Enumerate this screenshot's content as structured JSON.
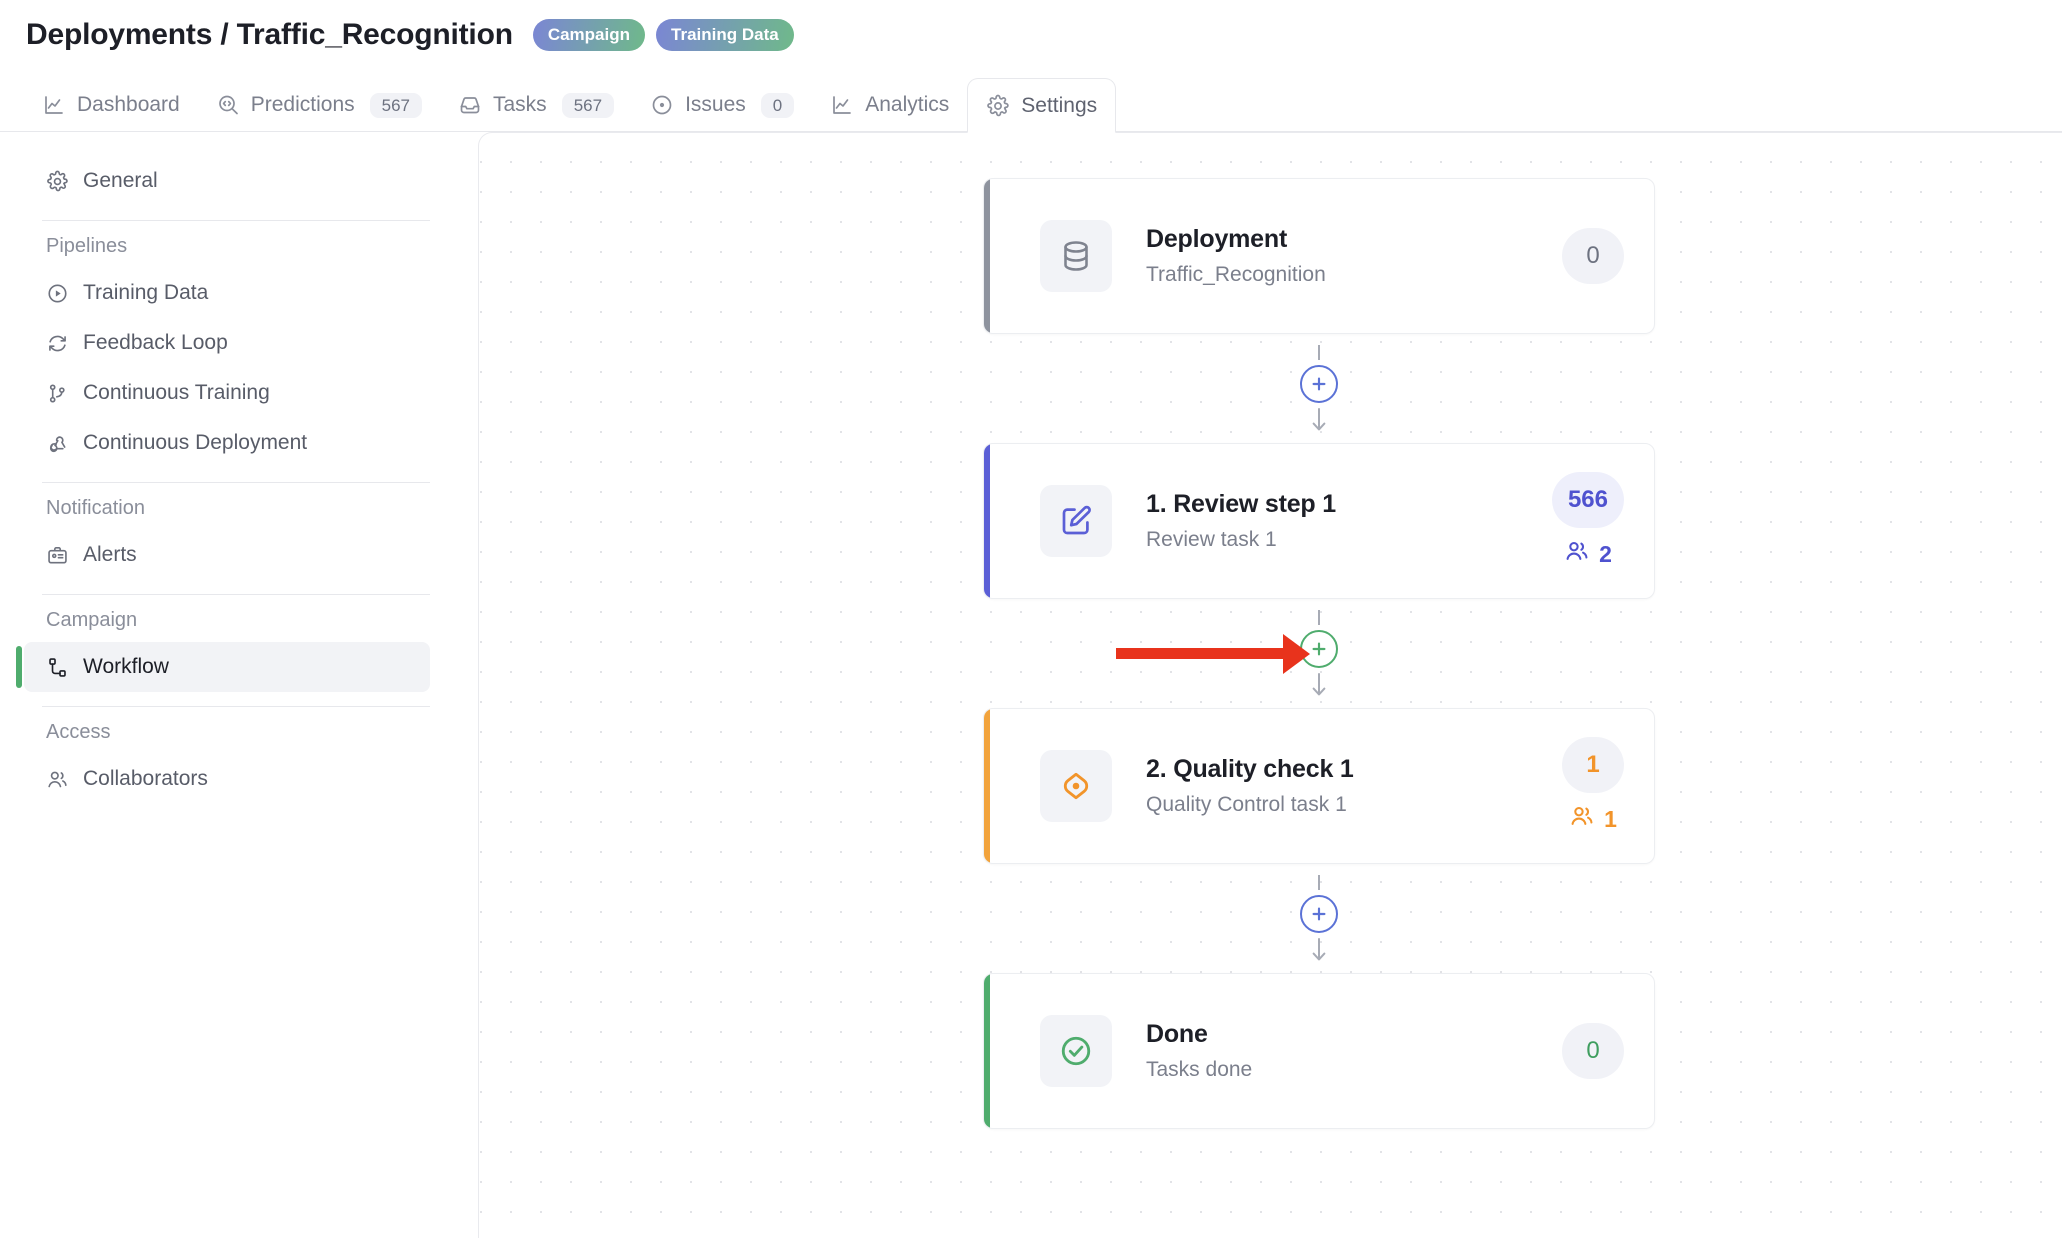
{
  "header": {
    "breadcrumb": "Deployments / Traffic_Recognition",
    "tags": [
      {
        "label": "Campaign",
        "color": "#7b86d4"
      },
      {
        "label": "Training Data",
        "color": "#7b86d4"
      }
    ]
  },
  "tabs": [
    {
      "label": "Dashboard",
      "icon": "chart-line-icon",
      "badge": null,
      "active": false
    },
    {
      "label": "Predictions",
      "icon": "code-search-icon",
      "badge": "567",
      "active": false
    },
    {
      "label": "Tasks",
      "icon": "inbox-icon",
      "badge": "567",
      "active": false
    },
    {
      "label": "Issues",
      "icon": "target-dot-icon",
      "badge": "0",
      "active": false
    },
    {
      "label": "Analytics",
      "icon": "chart-line-icon",
      "badge": null,
      "active": false
    },
    {
      "label": "Settings",
      "icon": "gear-icon",
      "badge": null,
      "active": true
    }
  ],
  "sidebar": {
    "top_item": {
      "label": "General",
      "icon": "gear-icon"
    },
    "groups": [
      {
        "title": "Pipelines",
        "items": [
          {
            "label": "Training Data",
            "icon": "play-circle-icon",
            "active": false
          },
          {
            "label": "Feedback Loop",
            "icon": "refresh-icon",
            "active": false
          },
          {
            "label": "Continuous Training",
            "icon": "git-branch-icon",
            "active": false
          },
          {
            "label": "Continuous Deployment",
            "icon": "webhook-icon",
            "active": false
          }
        ]
      },
      {
        "title": "Notification",
        "items": [
          {
            "label": "Alerts",
            "icon": "id-card-icon",
            "active": false
          }
        ]
      },
      {
        "title": "Campaign",
        "items": [
          {
            "label": "Workflow",
            "icon": "workflow-icon",
            "active": true
          }
        ]
      },
      {
        "title": "Access",
        "items": [
          {
            "label": "Collaborators",
            "icon": "users-icon",
            "active": false
          }
        ]
      }
    ],
    "active_accent": "#4fac6d"
  },
  "workflow": {
    "nodes": [
      {
        "title": "Deployment",
        "subtitle": "Traffic_Recognition",
        "count": "0",
        "assignees": null,
        "icon": "database-icon",
        "accent": "gray",
        "accent_color": "#8e939e"
      },
      {
        "title": "1. Review step 1",
        "subtitle": "Review task 1",
        "count": "566",
        "assignees": "2",
        "icon": "pencil-square-icon",
        "accent": "indigo",
        "accent_color": "#5b5fd6"
      },
      {
        "title": "2. Quality check 1",
        "subtitle": "Quality Control task 1",
        "count": "1",
        "assignees": "1",
        "icon": "eye-target-icon",
        "accent": "orange",
        "accent_color": "#f2a33c"
      },
      {
        "title": "Done",
        "subtitle": "Tasks done",
        "count": "0",
        "assignees": null,
        "icon": "check-circle-icon",
        "accent": "green",
        "accent_color": "#4fac6d"
      }
    ],
    "connectors": [
      {
        "state": "default",
        "color": "#5b72d6",
        "highlighted": false
      },
      {
        "state": "highlighted",
        "color": "#4fac6d",
        "highlighted": true
      },
      {
        "state": "default",
        "color": "#5b72d6",
        "highlighted": false
      }
    ],
    "annotation": {
      "type": "red-arrow",
      "color": "#e8331c",
      "points_to": "add-step-button-2"
    }
  }
}
